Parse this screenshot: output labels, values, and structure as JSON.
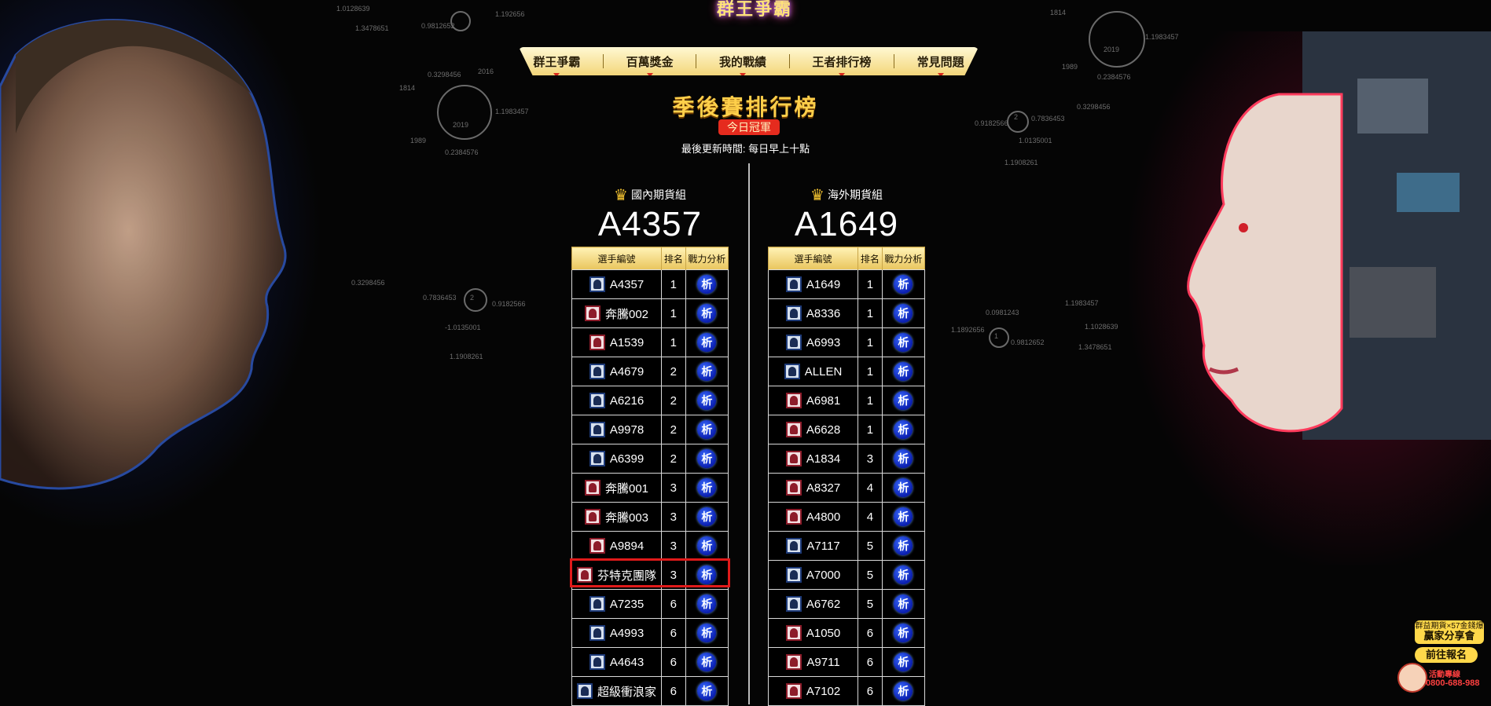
{
  "logo": {
    "text": "群王爭霸"
  },
  "nav": {
    "items": [
      {
        "label": "群王爭霸"
      },
      {
        "label": "百萬獎金"
      },
      {
        "label": "我的戰績"
      },
      {
        "label": "王者排行榜"
      },
      {
        "label": "常見問題"
      }
    ]
  },
  "heading": {
    "title": "季後賽排行榜",
    "badge": "今日冠軍",
    "update_time": "最後更新時間: 每日早上十點"
  },
  "columns": {
    "player": "選手編號",
    "rank": "排名",
    "analysis": "戰力分析"
  },
  "analysis_label": "析",
  "domestic": {
    "title": "國內期貨組",
    "champion": "A4357",
    "rows": [
      {
        "player": "A4357",
        "rank": "1",
        "avatar": "human"
      },
      {
        "player": "奔騰002",
        "rank": "1",
        "avatar": "robot"
      },
      {
        "player": "A1539",
        "rank": "1",
        "avatar": "robot"
      },
      {
        "player": "A4679",
        "rank": "2",
        "avatar": "human"
      },
      {
        "player": "A6216",
        "rank": "2",
        "avatar": "human"
      },
      {
        "player": "A9978",
        "rank": "2",
        "avatar": "human"
      },
      {
        "player": "A6399",
        "rank": "2",
        "avatar": "human"
      },
      {
        "player": "奔騰001",
        "rank": "3",
        "avatar": "robot"
      },
      {
        "player": "奔騰003",
        "rank": "3",
        "avatar": "robot"
      },
      {
        "player": "A9894",
        "rank": "3",
        "avatar": "robot"
      },
      {
        "player": "芬特克團隊",
        "rank": "3",
        "avatar": "robot"
      },
      {
        "player": "A7235",
        "rank": "6",
        "avatar": "human"
      },
      {
        "player": "A4993",
        "rank": "6",
        "avatar": "human"
      },
      {
        "player": "A4643",
        "rank": "6",
        "avatar": "human"
      },
      {
        "player": "超級衝浪家",
        "rank": "6",
        "avatar": "human"
      }
    ]
  },
  "overseas": {
    "title": "海外期貨組",
    "champion": "A1649",
    "rows": [
      {
        "player": "A1649",
        "rank": "1",
        "avatar": "human"
      },
      {
        "player": "A8336",
        "rank": "1",
        "avatar": "human"
      },
      {
        "player": "A6993",
        "rank": "1",
        "avatar": "human"
      },
      {
        "player": "ALLEN",
        "rank": "1",
        "avatar": "human"
      },
      {
        "player": "A6981",
        "rank": "1",
        "avatar": "robot"
      },
      {
        "player": "A6628",
        "rank": "1",
        "avatar": "robot"
      },
      {
        "player": "A1834",
        "rank": "3",
        "avatar": "robot"
      },
      {
        "player": "A8327",
        "rank": "4",
        "avatar": "robot"
      },
      {
        "player": "A4800",
        "rank": "4",
        "avatar": "robot"
      },
      {
        "player": "A7117",
        "rank": "5",
        "avatar": "human"
      },
      {
        "player": "A7000",
        "rank": "5",
        "avatar": "human"
      },
      {
        "player": "A6762",
        "rank": "5",
        "avatar": "human"
      },
      {
        "player": "A1050",
        "rank": "6",
        "avatar": "robot"
      },
      {
        "player": "A9711",
        "rank": "6",
        "avatar": "robot"
      },
      {
        "player": "A7102",
        "rank": "6",
        "avatar": "robot"
      }
    ]
  },
  "decor": {
    "left_top": [
      "1.0128639",
      "1.3478651",
      "0.9812652",
      "1.192656",
      "1"
    ],
    "left_mid": [
      "0.3298456",
      "2016",
      "1814",
      "1.1983457",
      "2019",
      "1989",
      "0.2384576"
    ],
    "left_low": [
      "0.3298456",
      "0.7836453",
      "2",
      "0.9182566",
      "-1.0135001",
      "1.1908261"
    ],
    "right_top": [
      "1814",
      "2019",
      "1.1983457",
      "1989",
      "0.2384576"
    ],
    "right_mid": [
      "0.9182566",
      "2",
      "0.7836453",
      "0.3298456",
      "1.0135001",
      "1.1908261"
    ],
    "right_low": [
      "0.0981243",
      "1.1983457",
      "1.1892656",
      "1",
      "0.9812652",
      "1.3478651",
      "1.1028639"
    ]
  },
  "promo": {
    "top_line": "群益期貨×57金錢爆",
    "title": "贏家分享會",
    "button": "前往報名",
    "hotline_label": "活動專線",
    "hotline": "0800-688-988"
  },
  "colors": {
    "accent_gold": "#ffcf4a",
    "badge_red": "#e52b1e",
    "highlight_red": "#e01a1a",
    "analysis_blue": "#0b1fb0"
  }
}
